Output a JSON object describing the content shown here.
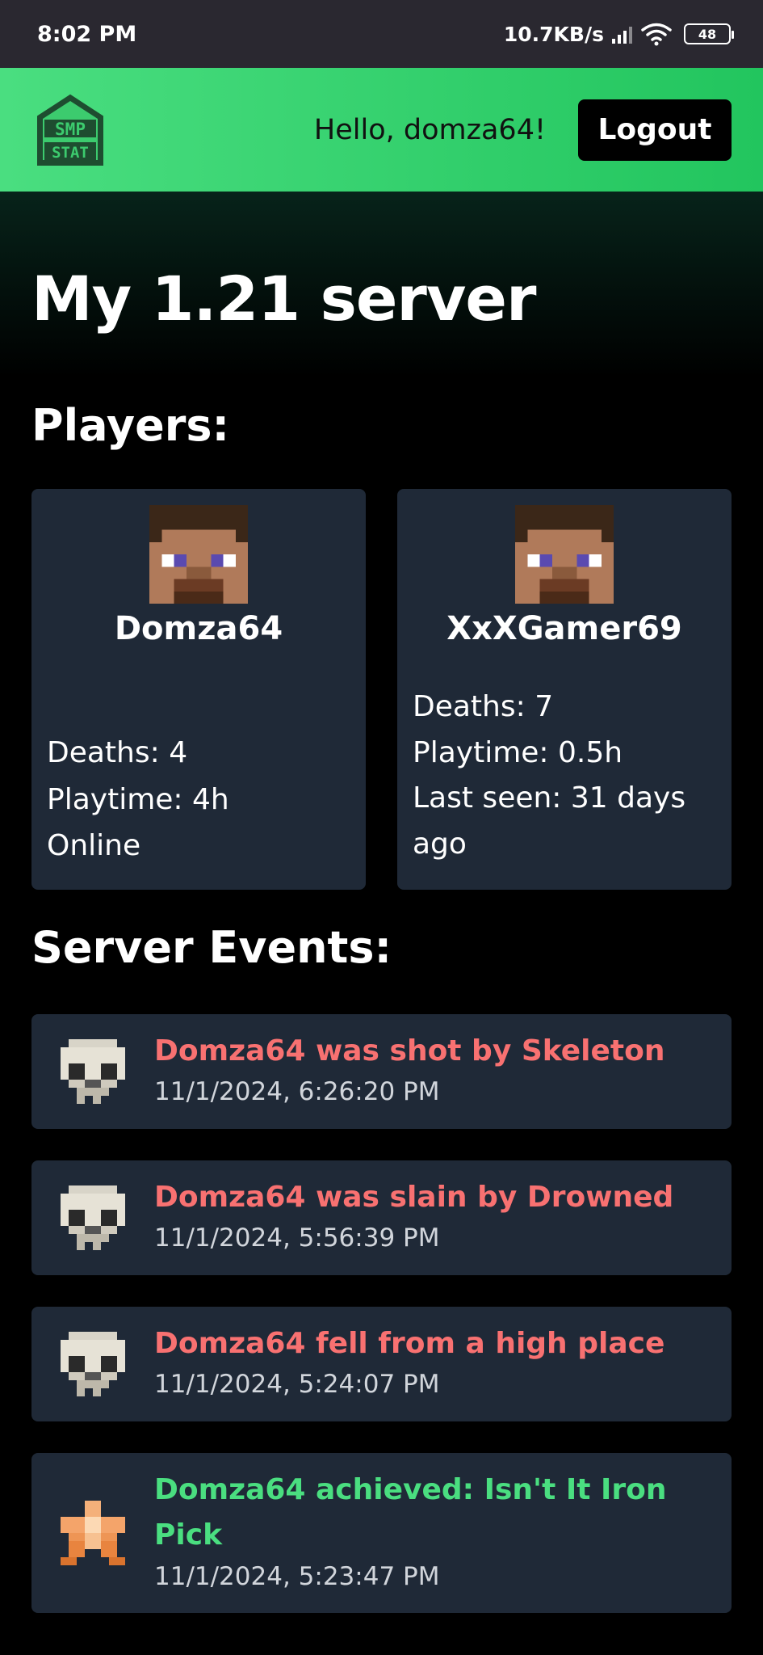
{
  "status_bar": {
    "time": "8:02 PM",
    "network_speed": "10.7KB/s",
    "battery": "48"
  },
  "header": {
    "logo_text": "SMP STAT",
    "greeting": "Hello, domza64!",
    "logout_label": "Logout",
    "accent": "#4ade80"
  },
  "page": {
    "title": "My 1.21 server",
    "players_heading": "Players:",
    "events_heading": "Server Events:"
  },
  "players": [
    {
      "name": "Domza64",
      "deaths_label": "Deaths:",
      "deaths": "4",
      "playtime_label": "Playtime:",
      "playtime": "4h",
      "status": "Online"
    },
    {
      "name": "XxXGamer69",
      "deaths_label": "Deaths:",
      "deaths": "7",
      "playtime_label": "Playtime:",
      "playtime": "0.5h",
      "last_seen_label": "Last seen:",
      "last_seen": "31 days ago"
    }
  ],
  "events": [
    {
      "text": "Domza64 was shot by Skeleton",
      "time": "11/1/2024, 6:26:20 PM",
      "icon": "skull-icon"
    },
    {
      "text": "Domza64 was slain by Drowned",
      "time": "11/1/2024, 5:56:39 PM",
      "icon": "skull-icon"
    },
    {
      "text": "Domza64 fell from a high place",
      "time": "11/1/2024, 5:24:07 PM",
      "icon": "skull-icon"
    },
    {
      "text": "Domza64 achieved: Isn't It Iron Pick",
      "time": "11/1/2024, 5:23:47 PM",
      "icon": "star-icon"
    }
  ]
}
